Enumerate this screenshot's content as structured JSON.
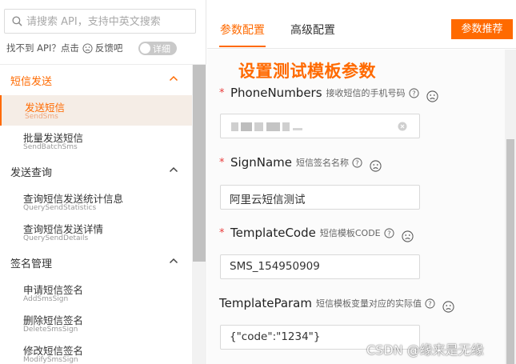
{
  "colors": {
    "accent": "#ff6a00",
    "required": "#e83b3b"
  },
  "search": {
    "placeholder": "请搜索 API，支持中英文搜索",
    "icon": "search-icon"
  },
  "feedback": {
    "text": "找不到 API？点击",
    "link": "反馈吧",
    "toggle_label": "详细"
  },
  "sidebar": {
    "groups": [
      {
        "title": "短信发送",
        "expanded": true,
        "active": true,
        "items": [
          {
            "label": "发送短信",
            "api": "SendSms",
            "active": true
          },
          {
            "label": "批量发送短信",
            "api": "SendBatchSms"
          }
        ]
      },
      {
        "title": "发送查询",
        "expanded": true,
        "items": [
          {
            "label": "查询短信发送统计信息",
            "api": "QuerySendStatistics"
          },
          {
            "label": "查询短信发送详情",
            "api": "QuerySendDetails"
          }
        ]
      },
      {
        "title": "签名管理",
        "expanded": true,
        "items": [
          {
            "label": "申请短信签名",
            "api": "AddSmsSign"
          },
          {
            "label": "删除短信签名",
            "api": "DeleteSmsSign"
          },
          {
            "label": "修改短信签名",
            "api": "ModifySmsSign"
          }
        ]
      }
    ]
  },
  "tabs": [
    {
      "label": "参数配置",
      "active": true
    },
    {
      "label": "高级配置"
    }
  ],
  "recommend_button": "参数推荐",
  "annotation": "设置测试模板参数",
  "fields": [
    {
      "name": "PhoneNumbers",
      "desc": "接收短信的手机号码",
      "required": true,
      "value": ""
    },
    {
      "name": "SignName",
      "desc": "短信签名名称",
      "required": true,
      "value": "阿里云短信测试"
    },
    {
      "name": "TemplateCode",
      "desc": "短信模板CODE",
      "required": true,
      "value": "SMS_154950909"
    },
    {
      "name": "TemplateParam",
      "desc": "短信模板变量对应的实际值",
      "required": false,
      "value": "{\"code\":\"1234\"}"
    }
  ],
  "watermark": "CSDN @缘来是无缘"
}
